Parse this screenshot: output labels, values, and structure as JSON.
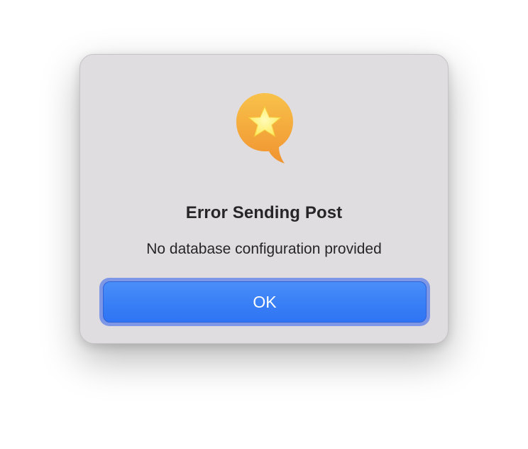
{
  "dialog": {
    "icon": "speech-bubble-star-icon",
    "title": "Error Sending Post",
    "message": "No database configuration provided",
    "ok_label": "OK"
  },
  "colors": {
    "dialog_background": "#e0dde0",
    "button_blue": "#3a80f6",
    "focus_ring": "#7d97e6",
    "icon_orange": "#f4a73c",
    "star_yellow": "#fff07a"
  }
}
